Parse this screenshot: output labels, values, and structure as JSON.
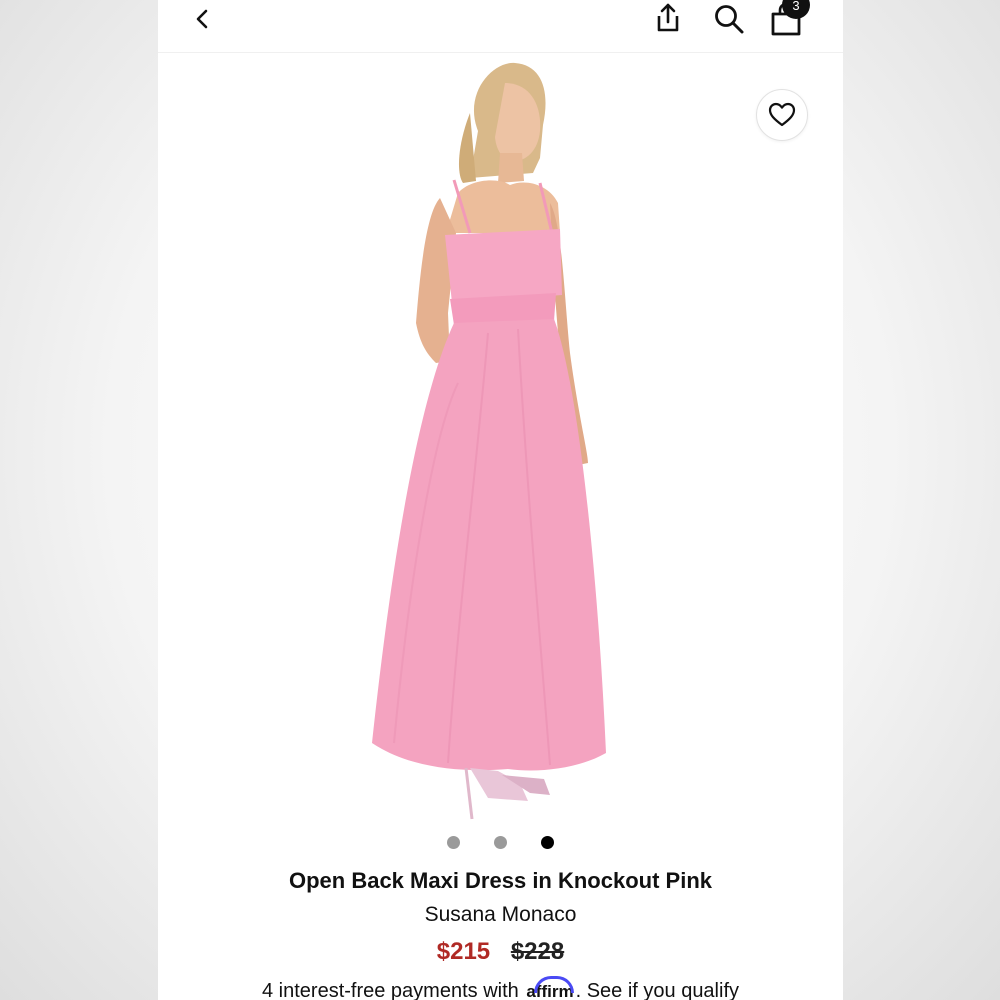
{
  "header": {
    "cart_count": "3"
  },
  "icons": {
    "back": "chevron-left-icon",
    "share": "share-icon",
    "search": "search-icon",
    "bag": "shopping-bag-icon",
    "wishlist": "heart-icon"
  },
  "gallery": {
    "image_count": 3,
    "active_index": 2
  },
  "product": {
    "name": "Open Back Maxi Dress in Knockout Pink",
    "brand": "Susana Monaco",
    "sale_price": "$215",
    "original_price": "$228"
  },
  "financing": {
    "text_before": "4 interest-free payments with",
    "provider": "affirm",
    "link_text": "See if you qualify"
  },
  "colors": {
    "sale_price": "#b02a25",
    "dress_pink": "#f4a3c0",
    "affirm_blue": "#4a4af4"
  }
}
